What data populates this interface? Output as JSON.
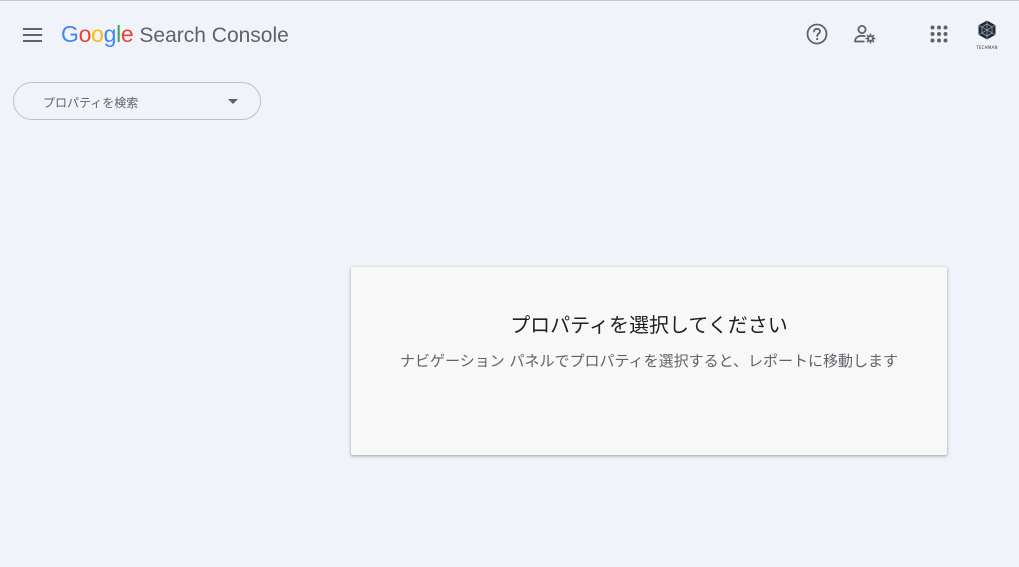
{
  "header": {
    "logo_letters": [
      {
        "char": "G",
        "color": "#4285F4"
      },
      {
        "char": "o",
        "color": "#EA4335"
      },
      {
        "char": "o",
        "color": "#FBBC05"
      },
      {
        "char": "g",
        "color": "#4285F4"
      },
      {
        "char": "l",
        "color": "#34A853"
      },
      {
        "char": "e",
        "color": "#EA4335"
      }
    ],
    "product_name": "Search Console",
    "icons": {
      "menu": "hamburger-menu-icon",
      "help": "help-circle-icon",
      "settings": "user-settings-icon",
      "apps": "apps-grid-icon"
    },
    "avatar_caption": "TECHMAN"
  },
  "property_search": {
    "placeholder": "プロパティを検索"
  },
  "empty_state": {
    "title": "プロパティを選択してください",
    "description": "ナビゲーション パネルでプロパティを選択すると、レポートに移動します"
  },
  "colors": {
    "page_background": "#f0f4fa",
    "card_background": "#f8f8f8",
    "icon_gray": "#5f6368"
  }
}
